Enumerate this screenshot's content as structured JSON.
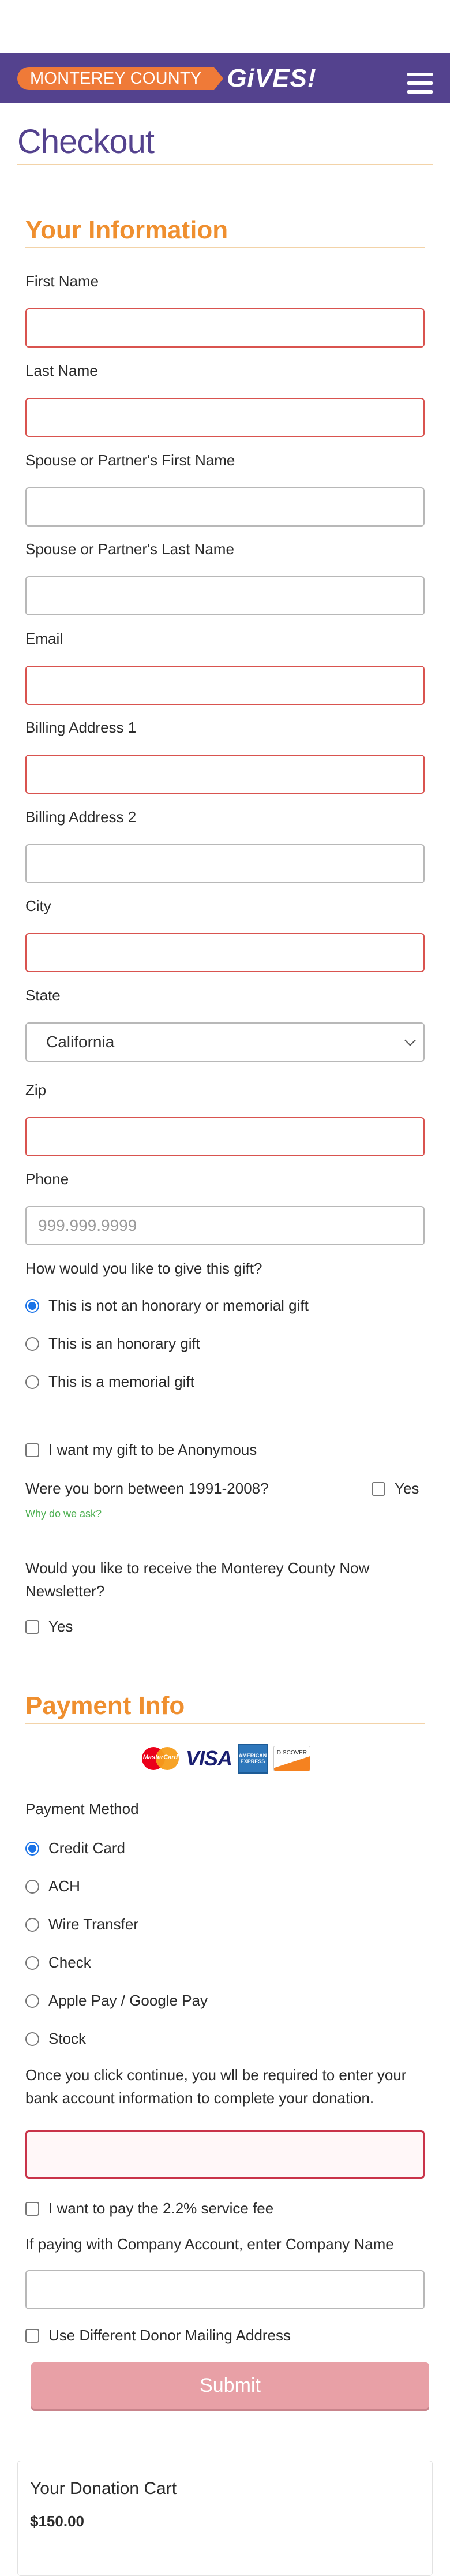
{
  "brand": {
    "logo_left": "MONTEREY COUNTY",
    "logo_right": "GiVES!",
    "colors": {
      "header": "#54428e",
      "accent": "#ef8f2f",
      "required": "#d9534f",
      "radio": "#1a73e8"
    }
  },
  "page": {
    "title": "Checkout"
  },
  "your_info": {
    "title": "Your Information",
    "first_name_label": "First Name",
    "last_name_label": "Last Name",
    "spouse_first_label": "Spouse or Partner's First Name",
    "spouse_last_label": "Spouse or Partner's Last Name",
    "email_label": "Email",
    "billing1_label": "Billing Address 1",
    "billing2_label": "Billing Address 2",
    "city_label": "City",
    "state_label": "State",
    "state_value": "California",
    "zip_label": "Zip",
    "phone_label": "Phone",
    "phone_placeholder": "999.999.9999",
    "gift_question": "How would you like to give this gift?",
    "gift_options": [
      "This is not an honorary or memorial gift",
      "This is an honorary gift",
      "This is a memorial gift"
    ],
    "anonymous_label": "I want my gift to be Anonymous",
    "born_question": "Were you born between 1991-2008?",
    "born_yes": "Yes",
    "why_link": "Why do we ask?",
    "newsletter_question": "Would you like to receive the Monterey County Now Newsletter?",
    "newsletter_yes": "Yes"
  },
  "payment": {
    "title": "Payment Info",
    "cards": {
      "mastercard": "MasterCard",
      "visa": "VISA",
      "amex": "AMERICAN EXPRESS",
      "discover": "DISCOVER"
    },
    "method_label": "Payment Method",
    "methods": [
      "Credit Card",
      "ACH",
      "Wire Transfer",
      "Check",
      "Apple Pay / Google Pay",
      "Stock"
    ],
    "selected_method": "Credit Card",
    "continue_note": "Once you click continue, you wll be required to enter your bank account information to complete your donation.",
    "service_fee_label": "I want to pay the 2.2% service fee",
    "company_label": "If paying with Company Account, enter Company Name",
    "different_address_label": "Use Different Donor Mailing Address",
    "submit_label": "Submit"
  },
  "cart": {
    "title": "Your Donation Cart",
    "total": "$150.00"
  }
}
